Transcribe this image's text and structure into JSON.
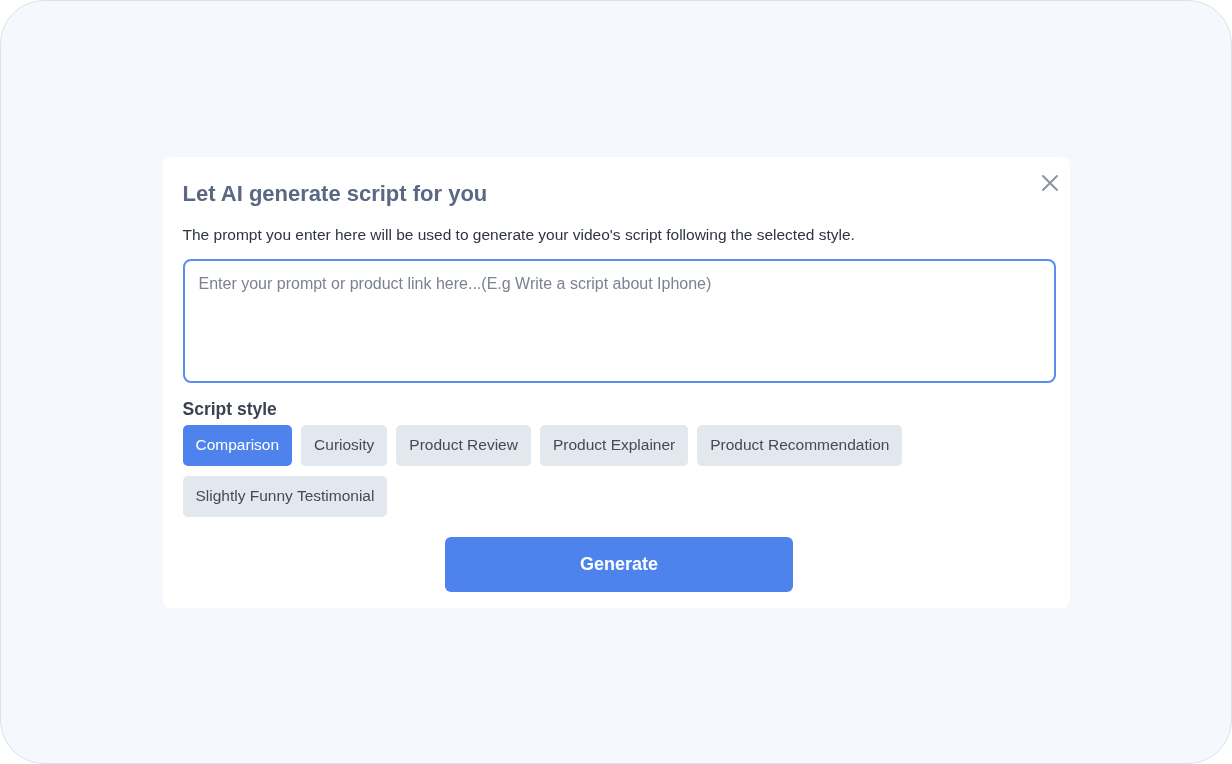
{
  "dialog": {
    "title": "Let AI generate script for you",
    "description": "The prompt you enter here will be used to generate your video's script following the selected style.",
    "prompt_field": {
      "placeholder": "Enter your prompt or product link here...(E.g Write a script about Iphone)"
    },
    "style_label": "Script style",
    "styles": [
      {
        "label": "Comparison",
        "selected": true
      },
      {
        "label": "Curiosity",
        "selected": false
      },
      {
        "label": "Product Review",
        "selected": false
      },
      {
        "label": "Product Explainer",
        "selected": false
      },
      {
        "label": "Product Recommendation",
        "selected": false
      },
      {
        "label": "Slightly Funny Testimonial",
        "selected": false
      }
    ],
    "generate_button": "Generate"
  }
}
